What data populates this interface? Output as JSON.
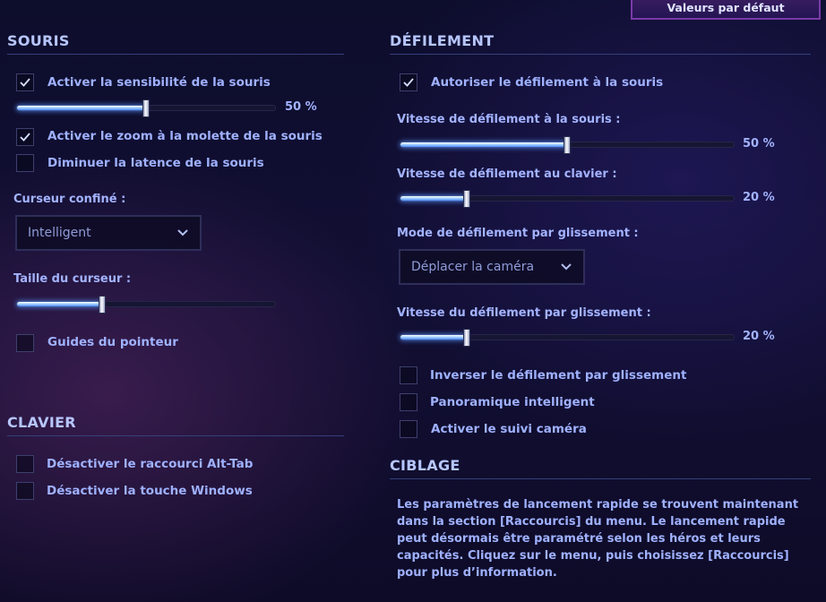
{
  "defaults_button": "Valeurs par défaut",
  "mouse": {
    "title": "SOURIS",
    "sensitivity": {
      "label": "Activer la sensibilité de la souris",
      "checked": true,
      "value": 50,
      "value_text": "50 %"
    },
    "wheel_zoom": {
      "label": "Activer le zoom à la molette de la souris",
      "checked": true
    },
    "reduce_latency": {
      "label": "Diminuer la latence de la souris",
      "checked": false
    },
    "confined_cursor": {
      "label": "Curseur confiné :",
      "selected": "Intelligent"
    },
    "cursor_size": {
      "label": "Taille du curseur :",
      "value": 33
    },
    "pointer_guides": {
      "label": "Guides du pointeur",
      "checked": false
    }
  },
  "keyboard": {
    "title": "CLAVIER",
    "disable_alt_tab": {
      "label": "Désactiver le raccourci Alt-Tab",
      "checked": false
    },
    "disable_windows_key": {
      "label": "Désactiver la touche Windows",
      "checked": false
    }
  },
  "scrolling": {
    "title": "DÉFILEMENT",
    "mouse_scroll": {
      "label": "Autoriser le défilement à la souris",
      "checked": true
    },
    "mouse_speed": {
      "label": "Vitesse de défilement à la souris :",
      "value": 50,
      "value_text": "50 %"
    },
    "keyboard_speed": {
      "label": "Vitesse de défilement au clavier :",
      "value": 20,
      "value_text": "20 %"
    },
    "drag_mode": {
      "label": "Mode de défilement par glissement :",
      "selected": "Déplacer la caméra"
    },
    "drag_speed": {
      "label": "Vitesse du défilement par glissement :",
      "value": 20,
      "value_text": "20 %"
    },
    "invert_drag": {
      "label": "Inverser le défilement par glissement",
      "checked": false
    },
    "smart_pan": {
      "label": "Panoramique intelligent",
      "checked": false
    },
    "camera_follow": {
      "label": "Activer le suivi caméra",
      "checked": false
    }
  },
  "targeting": {
    "title": "CIBLAGE",
    "info": "Les paramètres de lancement rapide se trouvent maintenant dans la section [Raccourcis] du menu. Le lancement rapide peut désormais être paramétré selon les héros et leurs capacités. Cliquez sur le menu, puis choisissez [Raccourcis] pour plus d’information."
  },
  "colors": {
    "accent": "#a9b8ff",
    "slider_fill": "#6aa8ff",
    "button_border": "#7a3aa8"
  }
}
